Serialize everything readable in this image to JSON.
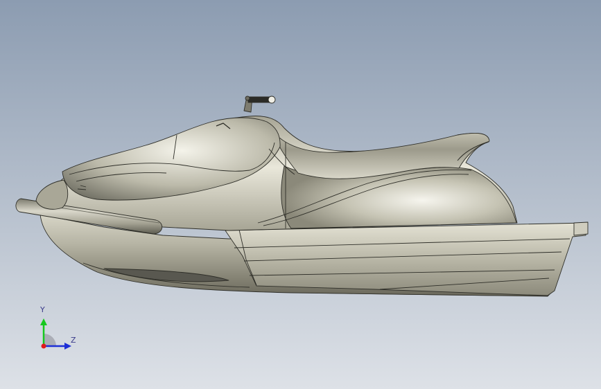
{
  "viewport": {
    "background_top": "#8c9cb1",
    "background_bottom": "#dde1e7"
  },
  "model": {
    "name_icon": "jet-ski-model",
    "body_color": "#b2b09f",
    "body_light": "#eceade",
    "body_dark": "#5f5e53",
    "edge_color": "#2e2e28"
  },
  "triad": {
    "y_label": "Y",
    "z_label": "Z",
    "y_color": "#16c81e",
    "z_color": "#1d2fd6",
    "x_color": "#e01b1b",
    "label_color": "#3a3a8a"
  }
}
